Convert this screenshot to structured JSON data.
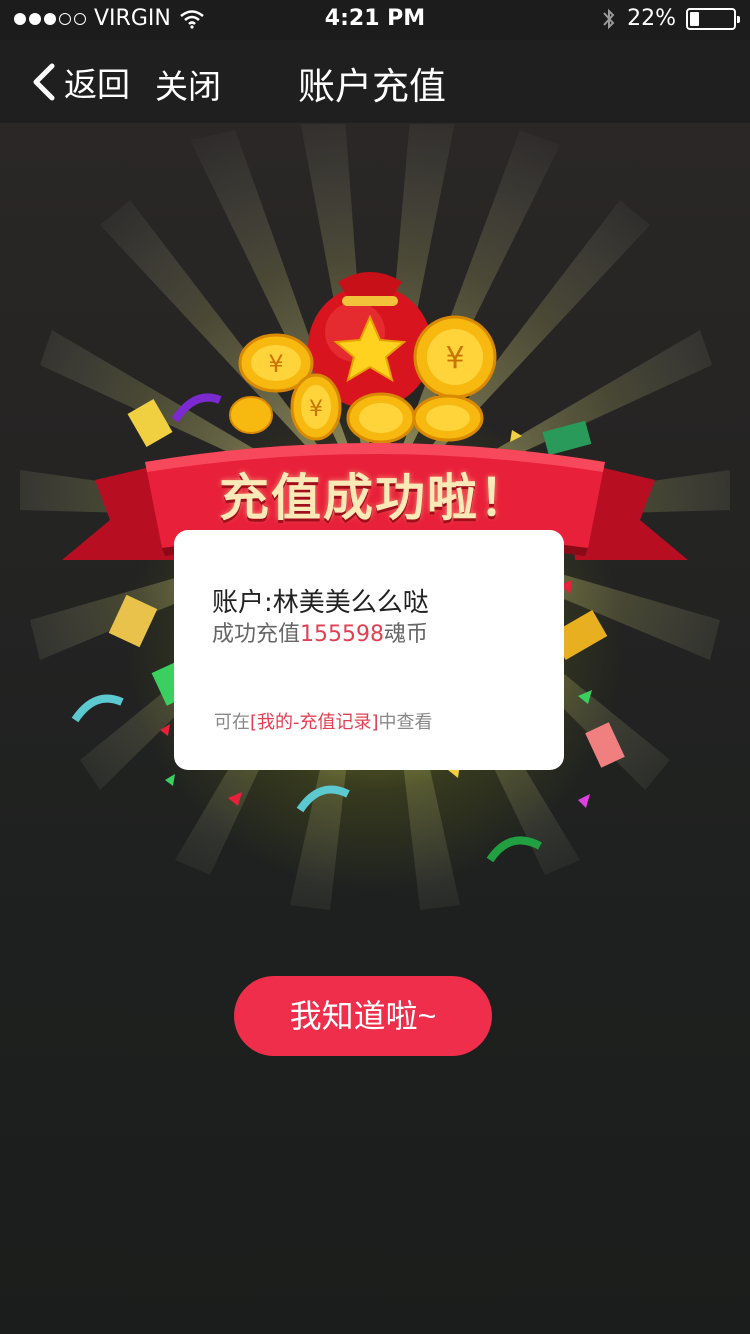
{
  "status_bar": {
    "carrier": "VIRGIN",
    "time": "4:21 PM",
    "battery_percent": "22%",
    "battery_level": 0.22,
    "icons": [
      "signal-dots-icon",
      "wifi-icon",
      "bluetooth-icon",
      "battery-icon"
    ]
  },
  "nav": {
    "back_label": "返回",
    "close_label": "关闭",
    "title": "账户充值"
  },
  "banner": {
    "title": "充值成功啦！",
    "icons": [
      "money-bag-icon",
      "gold-coin-icon",
      "star-icon",
      "confetti-icon",
      "red-envelope-icon",
      "banknote-icon"
    ]
  },
  "card": {
    "account_prefix": "账户:",
    "account_name": "林美美么么哒",
    "recharge_prefix": "成功充值",
    "recharge_amount": "155598",
    "recharge_unit": "魂币",
    "hint_prefix": "可在",
    "hint_link": "[我的-充值记录]",
    "hint_suffix": "中查看"
  },
  "confirm_button": {
    "label": "我知道啦~"
  },
  "colors": {
    "accent": "#ee2e4a",
    "ribbon": "#e8203a",
    "title_text": "#fbe9b8",
    "glow": "#e6f03c"
  }
}
